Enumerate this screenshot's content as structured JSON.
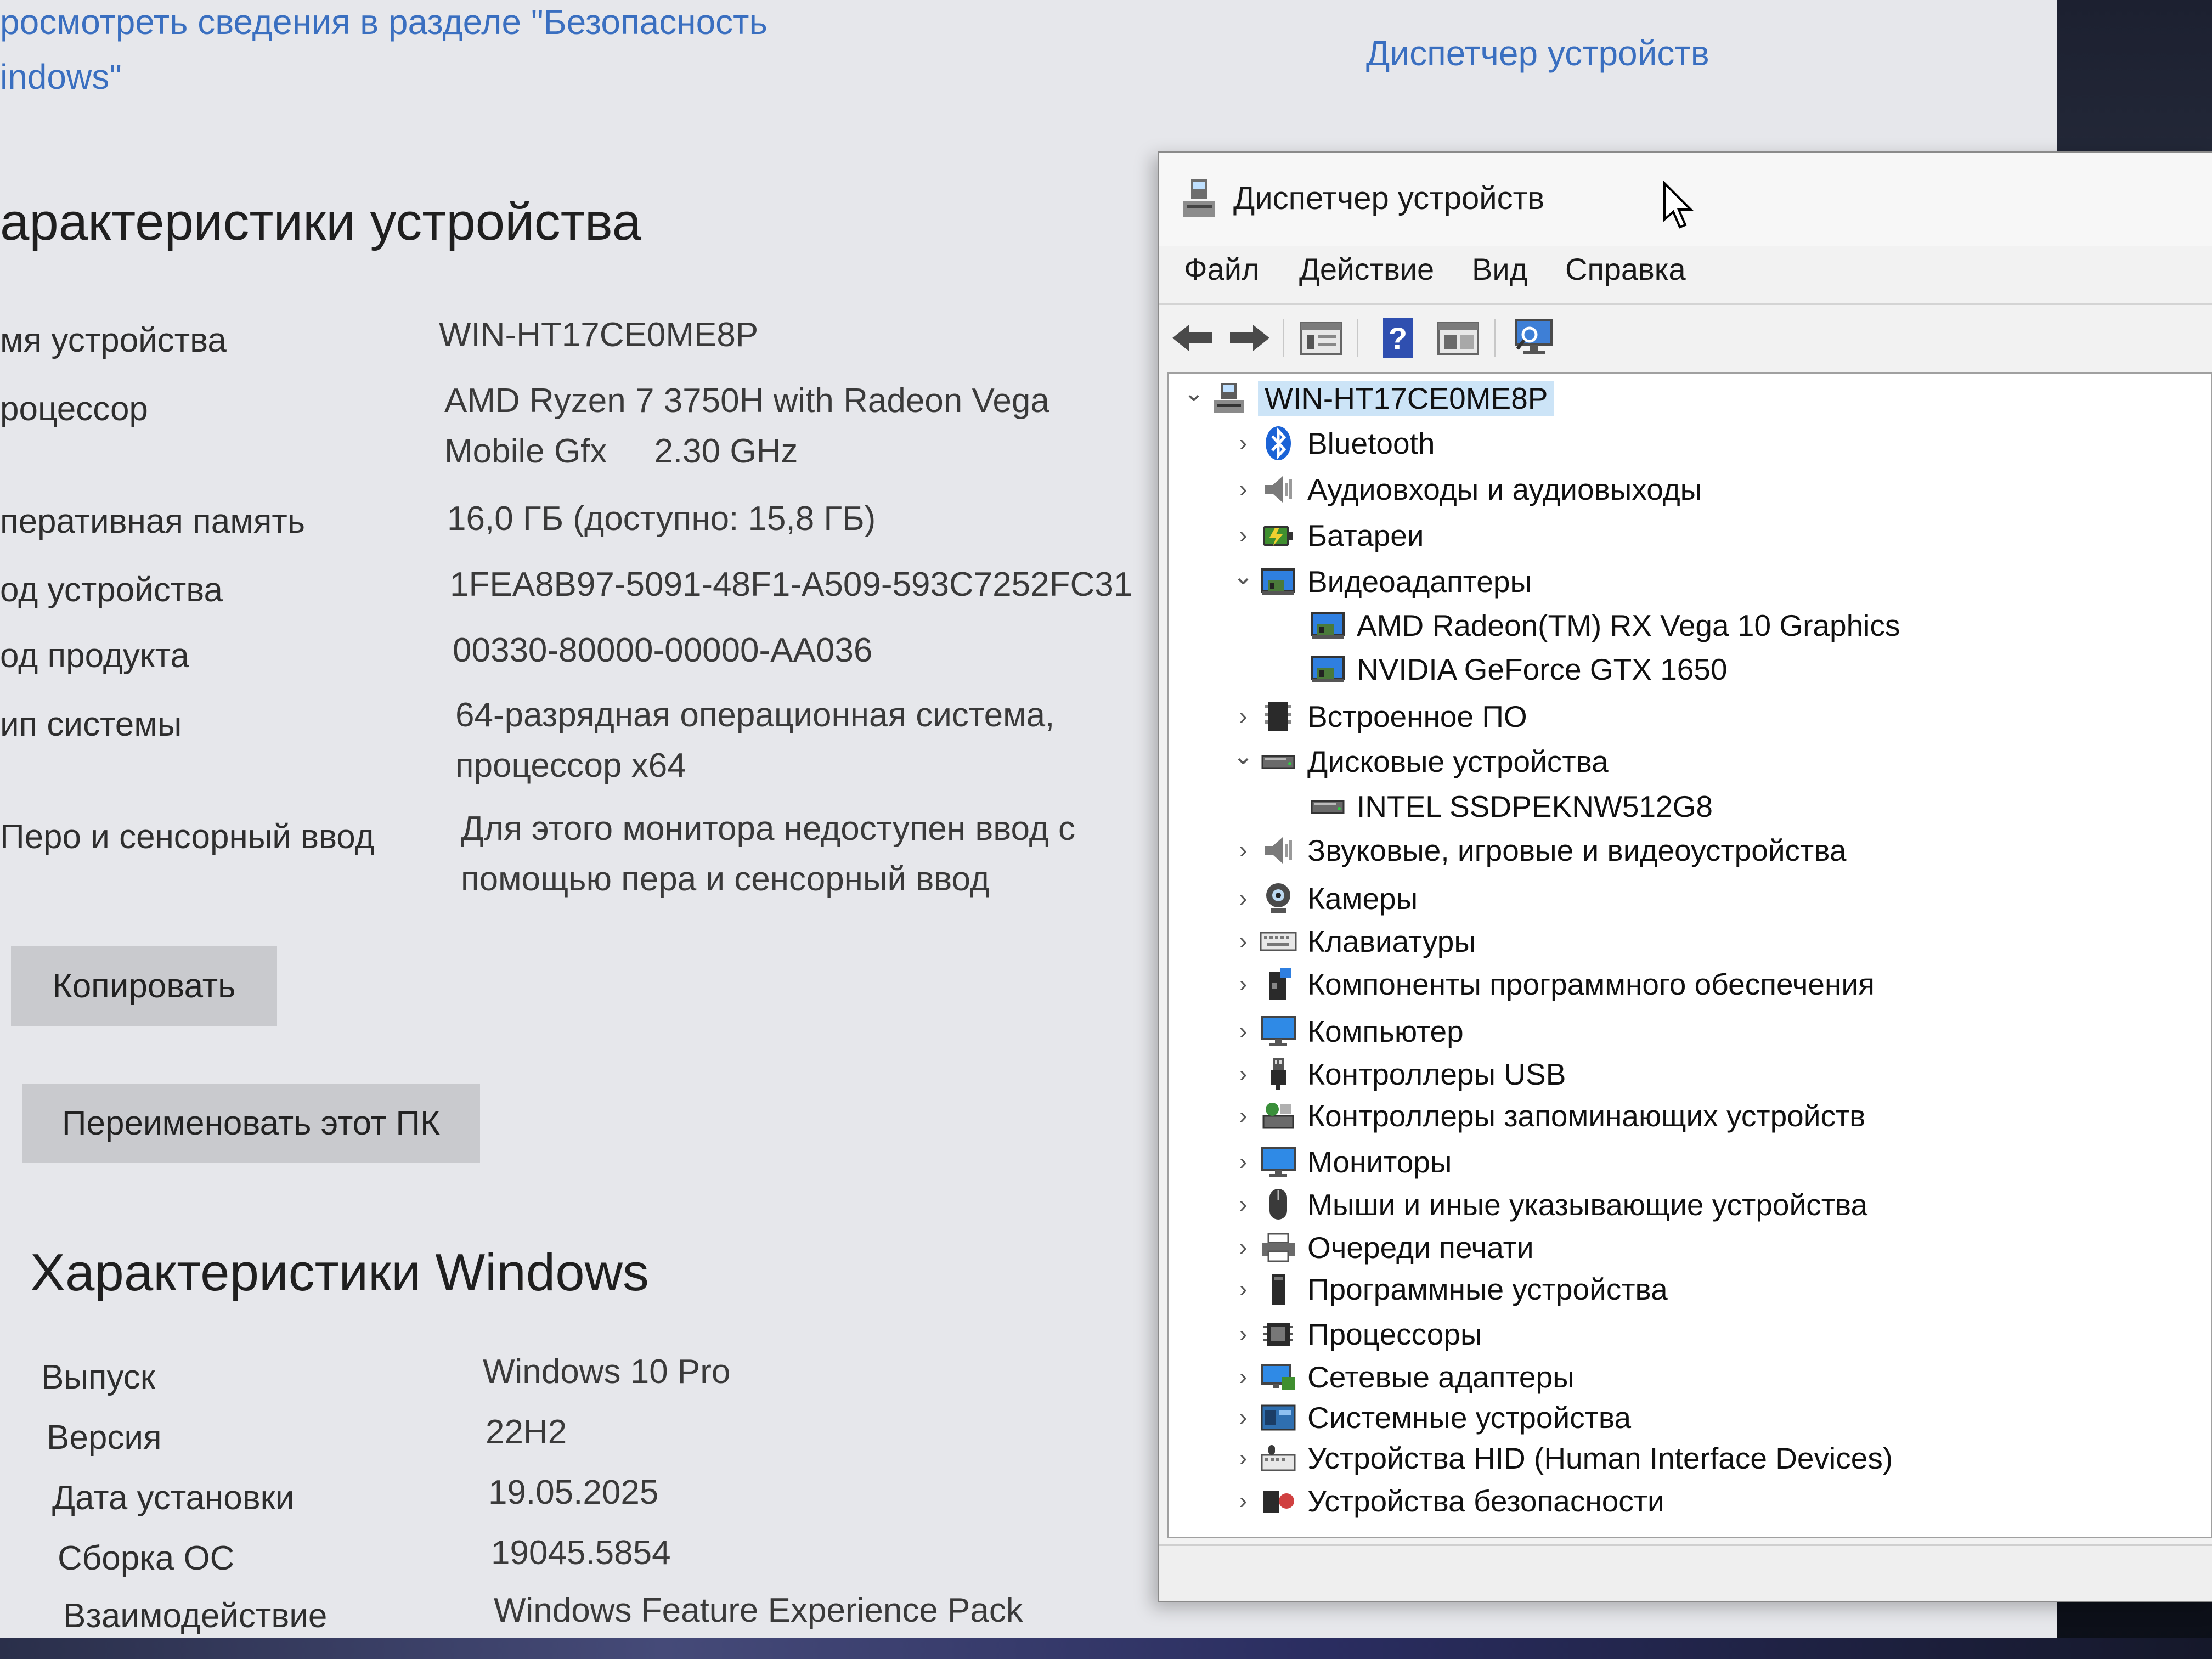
{
  "settings": {
    "security_link": "росмотреть сведения в разделе \"Безопасность",
    "security_link_line2": "indows\"",
    "device_manager_link": "Диспетчер устройств",
    "device_specs": {
      "title": "арактеристики устройства",
      "rows": [
        {
          "label": "мя устройства",
          "value": "WIN-HT17CE0ME8P"
        },
        {
          "label": "роцессор",
          "value": "AMD Ryzen 7 3750H with Radeon Vega",
          "value2": "Mobile Gfx     2.30 GHz"
        },
        {
          "label": "перативная память",
          "value": "16,0 ГБ (доступно: 15,8 ГБ)"
        },
        {
          "label": "од устройства",
          "value": "1FEA8B97-5091-48F1-A509-593C7252FC31"
        },
        {
          "label": "од продукта",
          "value": "00330-80000-00000-AA036"
        },
        {
          "label": "ип системы",
          "value": "64-разрядная операционная система,",
          "value2": "процессор x64"
        },
        {
          "label": "Перо и сенсорный ввод",
          "value": "Для этого монитора недоступен ввод с",
          "value2": "помощью пера и сенсорный ввод"
        }
      ],
      "copy_button": "Копировать",
      "rename_button": "Переименовать этот ПК"
    },
    "windows_specs": {
      "title": "Характеристики Windows",
      "rows": [
        {
          "label": "Выпуск",
          "value": "Windows 10 Pro"
        },
        {
          "label": "Версия",
          "value": "22H2"
        },
        {
          "label": "Дата установки",
          "value": "19.05.2025"
        },
        {
          "label": "Сборка ОС",
          "value": "19045.5854"
        },
        {
          "label": "Взаимодействие",
          "value": "Windows Feature Experience Pack"
        }
      ]
    }
  },
  "device_manager": {
    "title": "Диспетчер устройств",
    "menu": [
      "Файл",
      "Действие",
      "Вид",
      "Справка"
    ],
    "toolbar_icons": [
      "back-arrow-icon",
      "forward-arrow-icon",
      "properties-icon",
      "help-icon",
      "update-driver-icon",
      "scan-hardware-icon"
    ],
    "tree": [
      {
        "label": "WIN-HT17CE0ME8P",
        "level": 0,
        "expanded": true,
        "icon": "computer-icon"
      },
      {
        "label": "Bluetooth",
        "level": 1,
        "expanded": false,
        "icon": "bluetooth-icon"
      },
      {
        "label": "Аудиовходы и аудиовыходы",
        "level": 1,
        "expanded": false,
        "icon": "speaker-icon"
      },
      {
        "label": "Батареи",
        "level": 1,
        "expanded": false,
        "icon": "battery-icon"
      },
      {
        "label": "Видеоадаптеры",
        "level": 1,
        "expanded": true,
        "icon": "display-adapter-icon"
      },
      {
        "label": "AMD Radeon(TM) RX Vega 10 Graphics",
        "level": 2,
        "icon": "display-adapter-icon"
      },
      {
        "label": "NVIDIA GeForce GTX 1650",
        "level": 2,
        "icon": "display-adapter-icon"
      },
      {
        "label": "Встроенное ПО",
        "level": 1,
        "expanded": false,
        "icon": "firmware-icon"
      },
      {
        "label": "Дисковые устройства",
        "level": 1,
        "expanded": true,
        "icon": "disk-drive-icon"
      },
      {
        "label": "INTEL SSDPEKNW512G8",
        "level": 2,
        "icon": "disk-drive-icon"
      },
      {
        "label": "Звуковые, игровые и видеоустройства",
        "level": 1,
        "expanded": false,
        "icon": "sound-icon"
      },
      {
        "label": "Камеры",
        "level": 1,
        "expanded": false,
        "icon": "camera-icon"
      },
      {
        "label": "Клавиатуры",
        "level": 1,
        "expanded": false,
        "icon": "keyboard-icon"
      },
      {
        "label": "Компоненты программного обеспечения",
        "level": 1,
        "expanded": false,
        "icon": "software-component-icon"
      },
      {
        "label": "Компьютер",
        "level": 1,
        "expanded": false,
        "icon": "monitor-icon"
      },
      {
        "label": "Контроллеры USB",
        "level": 1,
        "expanded": false,
        "icon": "usb-icon"
      },
      {
        "label": "Контроллеры запоминающих устройств",
        "level": 1,
        "expanded": false,
        "icon": "storage-controller-icon"
      },
      {
        "label": "Мониторы",
        "level": 1,
        "expanded": false,
        "icon": "monitor-icon"
      },
      {
        "label": "Мыши и иные указывающие устройства",
        "level": 1,
        "expanded": false,
        "icon": "mouse-icon"
      },
      {
        "label": "Очереди печати",
        "level": 1,
        "expanded": false,
        "icon": "printer-icon"
      },
      {
        "label": "Программные устройства",
        "level": 1,
        "expanded": false,
        "icon": "software-device-icon"
      },
      {
        "label": "Процессоры",
        "level": 1,
        "expanded": false,
        "icon": "processor-icon"
      },
      {
        "label": "Сетевые адаптеры",
        "level": 1,
        "expanded": false,
        "icon": "network-adapter-icon"
      },
      {
        "label": "Системные устройства",
        "level": 1,
        "expanded": false,
        "icon": "system-device-icon"
      },
      {
        "label": "Устройства HID (Human Interface Devices)",
        "level": 1,
        "expanded": false,
        "icon": "hid-icon"
      },
      {
        "label": "Устройства безопасности",
        "level": 1,
        "expanded": false,
        "icon": "security-device-icon"
      }
    ]
  }
}
